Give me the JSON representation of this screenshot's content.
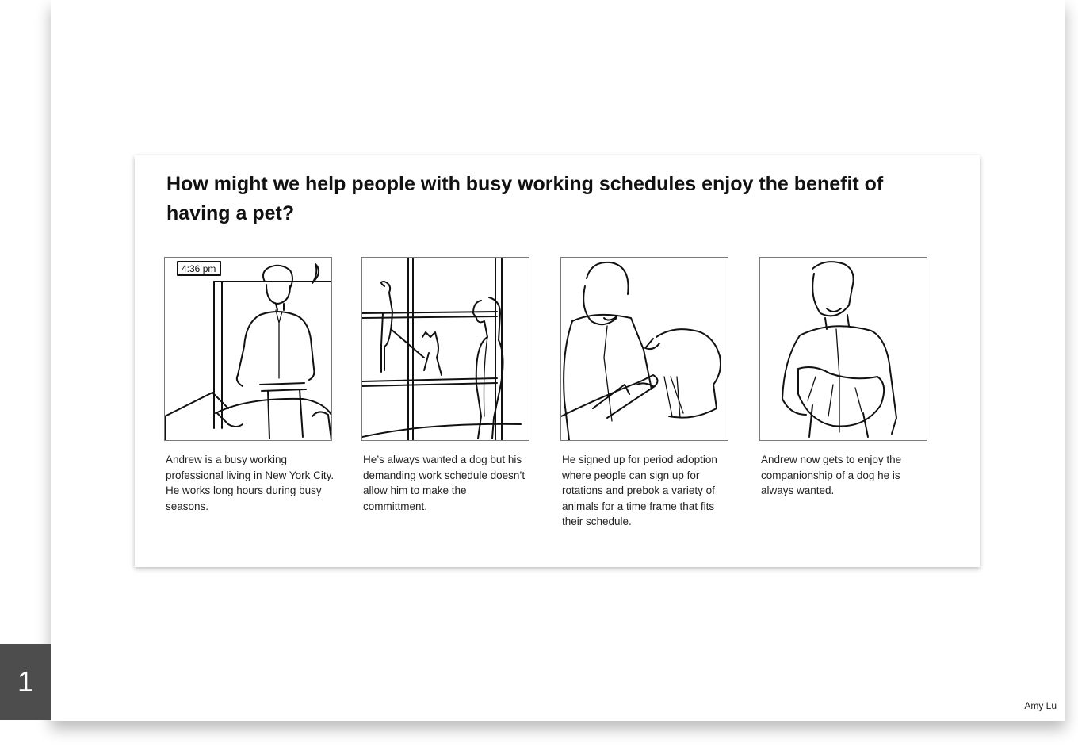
{
  "slide": {
    "title": "How might we help people with busy working schedules enjoy the benefit of having a pet?",
    "panels": [
      {
        "caption": "Andrew is a busy working professional living in New York City. He works long hours during busy seasons.",
        "clock_text": "4:36 pm"
      },
      {
        "caption": "He’s always wanted a dog but his demanding work schedule doesn’t allow him to make the committment."
      },
      {
        "caption": "He signed up for period adoption where people can sign up for rotations and prebok a variety of animals for a time frame that fits their schedule."
      },
      {
        "caption": "Andrew now gets to enjoy the companionship of a dog he is always wanted."
      }
    ],
    "page_number": "1",
    "author": "Amy Lu"
  }
}
